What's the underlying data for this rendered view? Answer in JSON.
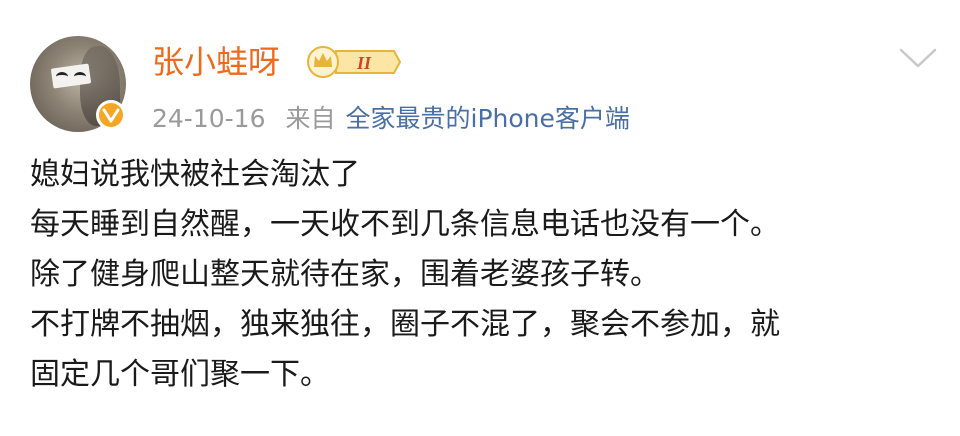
{
  "user": {
    "name": "张小蛙呀",
    "level_badge": "II",
    "verified_mark": "v"
  },
  "meta": {
    "date": "24-10-16",
    "from_label": "来自",
    "client": "全家最贵的iPhone客户端"
  },
  "post": {
    "lines": [
      "媳妇说我快被社会淘汰了",
      "每天睡到自然醒，一天收不到几条信息电话也没有一个。",
      "除了健身爬山整天就待在家，围着老婆孩子转。",
      "不打牌不抽烟，独来独往，圈子不混了，聚会不参加，就",
      "固定几个哥们聚一下。"
    ]
  },
  "colors": {
    "username": "#f06a1d",
    "client_link": "#4a6fa5",
    "meta_text": "#9a9a9a",
    "verified": "#f5a623",
    "badge_gold": "#e8b43a"
  },
  "icons": {
    "verified": "verified-badge-icon",
    "level": "crown-level-badge-icon",
    "dropdown": "chevron-down-icon"
  }
}
